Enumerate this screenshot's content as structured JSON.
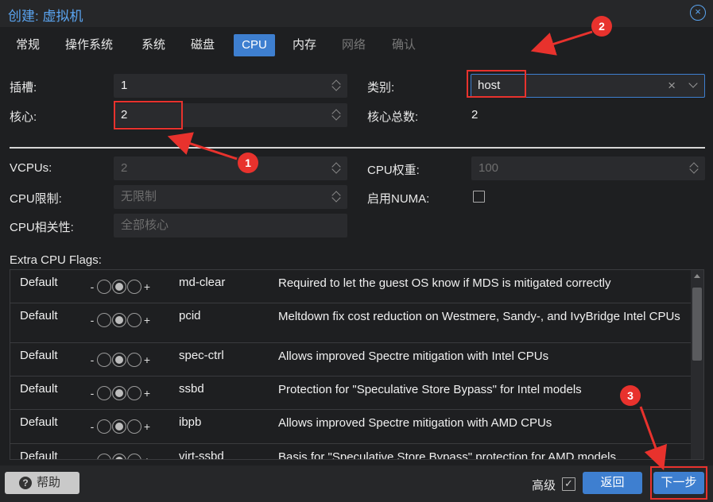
{
  "window": {
    "title": "创建: 虚拟机",
    "close_icon": "×"
  },
  "tabs": [
    {
      "label": "常规",
      "state": "normal"
    },
    {
      "label": "操作系统",
      "state": "normal"
    },
    {
      "label": "系统",
      "state": "normal"
    },
    {
      "label": "磁盘",
      "state": "normal"
    },
    {
      "label": "CPU",
      "state": "active"
    },
    {
      "label": "内存",
      "state": "normal"
    },
    {
      "label": "网络",
      "state": "disabled"
    },
    {
      "label": "确认",
      "state": "disabled"
    }
  ],
  "cpu": {
    "sockets_label": "插槽:",
    "sockets_value": "1",
    "cores_label": "核心:",
    "cores_value": "2",
    "type_label": "类别:",
    "type_value": "host",
    "type_clear_icon": "×",
    "total_cores_label": "核心总数:",
    "total_cores_value": "2",
    "vcpus_label": "VCPUs:",
    "vcpus_value": "2",
    "cpu_weight_label": "CPU权重:",
    "cpu_weight_value": "100",
    "cpu_limit_label": "CPU限制:",
    "cpu_limit_value": "无限制",
    "numa_label": "启用NUMA:",
    "affinity_label": "CPU相关性:",
    "affinity_value": "全部核心"
  },
  "flags": {
    "label": "Extra CPU Flags:",
    "minus": "-",
    "plus": "+",
    "rows": [
      {
        "state": "Default",
        "name": "md-clear",
        "desc": "Required to let the guest OS know if MDS is mitigated correctly"
      },
      {
        "state": "Default",
        "name": "pcid",
        "desc": "Meltdown fix cost reduction on Westmere, Sandy-, and IvyBridge Intel CPUs"
      },
      {
        "state": "Default",
        "name": "spec-ctrl",
        "desc": "Allows improved Spectre mitigation with Intel CPUs"
      },
      {
        "state": "Default",
        "name": "ssbd",
        "desc": "Protection for \"Speculative Store Bypass\" for Intel models"
      },
      {
        "state": "Default",
        "name": "ibpb",
        "desc": "Allows improved Spectre mitigation with AMD CPUs"
      },
      {
        "state": "Default",
        "name": "virt-ssbd",
        "desc": "Basis for \"Speculative Store Bypass\" protection for AMD models"
      }
    ]
  },
  "footer": {
    "help_label": "帮助",
    "help_icon": "?",
    "advanced_label": "高级",
    "advanced_check": "✓",
    "back_label": "返回",
    "next_label": "下一步"
  },
  "annotations": {
    "badge1": "1",
    "badge2": "2",
    "badge3": "3",
    "color": "#e8322d"
  },
  "colors": {
    "accent": "#3e7fd0",
    "title": "#5aa4f0",
    "background": "#1e1f21"
  }
}
